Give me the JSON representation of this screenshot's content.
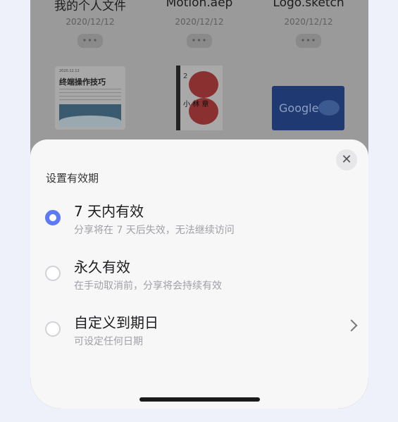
{
  "background_files": [
    {
      "name": "我的个人文件",
      "date": "2020/12/12",
      "more": "•••"
    },
    {
      "name": "Motion.aep",
      "date": "2020/12/12",
      "more": "•••"
    },
    {
      "name": "Logo.sketch",
      "date": "2020/12/12",
      "more": "•••"
    }
  ],
  "thumbnails": {
    "doc": {
      "date": "2020.12.12",
      "title": "终端操作技巧"
    },
    "book": {
      "number": "2",
      "author": "小 林 章"
    },
    "slide": {
      "logo_text": "Google"
    }
  },
  "sheet": {
    "title": "设置有效期",
    "close_icon": "close-icon",
    "options": [
      {
        "title": "7 天内有效",
        "subtitle": "分享将在 7 天后失效，无法继续访问",
        "selected": true
      },
      {
        "title": "永久有效",
        "subtitle": "在手动取消前，分享将会持续有效",
        "selected": false
      },
      {
        "title": "自定义到期日",
        "subtitle": "可设定任何日期",
        "selected": false,
        "has_chevron": true
      }
    ]
  },
  "colors": {
    "accent": "#5d7af5",
    "sheet_bg": "#f7f7f8",
    "page_bg": "#eef1fa"
  }
}
